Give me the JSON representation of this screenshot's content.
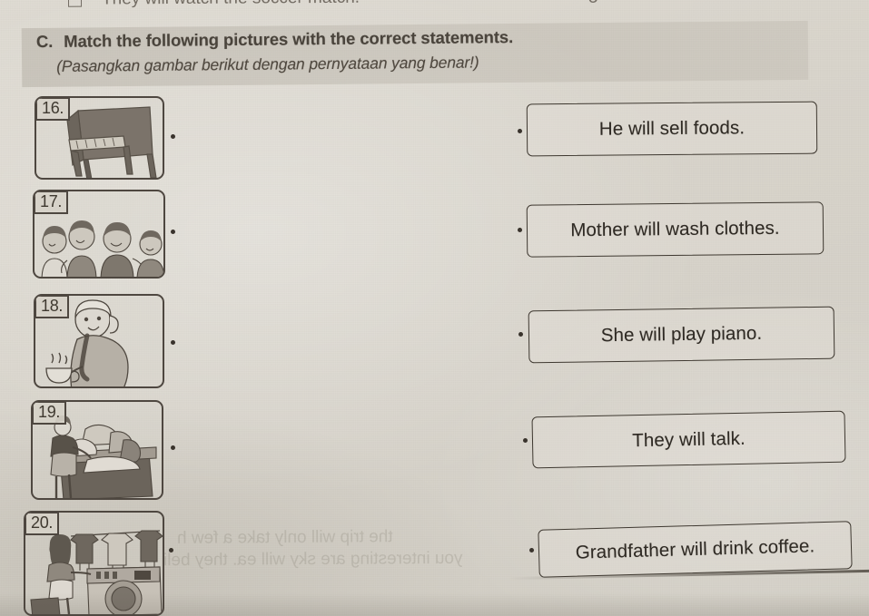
{
  "page": {
    "background_color": "#d8d4cc",
    "ink_color": "#3e3830",
    "band_color": "#968f83",
    "cut_off_top_text": "They will watch the soccer match.",
    "cut_off_top_tail": "5"
  },
  "header": {
    "letter": "C.",
    "instruction": "Match the following pictures with the correct statements.",
    "translation": "(Pasangkan gambar berikut dengan pernyataan yang benar!)"
  },
  "pictures": [
    {
      "number": "16.",
      "alt": "An upright piano",
      "icon": "piano-icon"
    },
    {
      "number": "17.",
      "alt": "Four children talking to each other",
      "icon": "children-talking-icon"
    },
    {
      "number": "18.",
      "alt": "A man holding a steaming cup of coffee",
      "icon": "man-with-cup-icon"
    },
    {
      "number": "19.",
      "alt": "A street vendor selling food at a stall",
      "icon": "food-vendor-icon"
    },
    {
      "number": "20.",
      "alt": "A woman washing clothes with a washing machine and laundry hanging on a line",
      "icon": "washing-clothes-icon"
    }
  ],
  "statements": [
    {
      "text": "He will sell foods."
    },
    {
      "text": "Mother will wash clothes."
    },
    {
      "text": "She will play piano."
    },
    {
      "text": "They will talk."
    },
    {
      "text": "Grandfather will drink coffee."
    }
  ],
  "bleed_through": {
    "line_a": "the trip will only take a few h",
    "line_b": "you interesting are sky will ea. they beli"
  }
}
